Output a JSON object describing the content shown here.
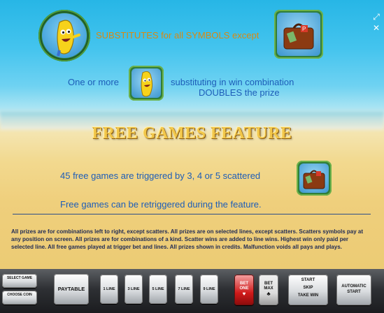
{
  "paytable": {
    "line1": "SUBSTITUTES for all SYMBOLS except",
    "line2_left": "One or more",
    "line2_right": "substituting in win combination",
    "line3": "DOUBLES the prize",
    "feature_title": "FREE GAMES FEATURE",
    "free_games_text": "45 free games are triggered by 3, 4 or 5 scattered",
    "retrigger_text": "Free games can be retriggered during the feature.",
    "terms": "All prizes are for combinations left to right, except scatters. All prizes are on selected lines, except scatters. Scatters symbols pay at any position on screen. All prizes are for combinations of a kind. Scatter wins are added to line wins. Highest win only paid per selected line. All free games played at trigger bet and lines. All prizes shown in credits. Malfunction voids all pays and plays."
  },
  "symbols": {
    "wild": "banana-wild-symbol",
    "scatter": "suitcase-scatter-symbol"
  },
  "side_icons": [
    "fullscreen-icon",
    "close-icon"
  ],
  "controls": {
    "select_game": "SELECT GAME",
    "choose_coin": "CHOOSE COIN",
    "paytable": "PAYTABLE",
    "lines": [
      "1 LINE",
      "3 LINE",
      "5 LINE",
      "7 LINE",
      "9 LINE"
    ],
    "bet_one": "BET ONE",
    "bet_max": "BET MAX",
    "start": "START",
    "skip": "SKIP",
    "take_win": "TAKE WIN",
    "automatic_start": "AUTOMATIC START"
  },
  "colors": {
    "gold_text": "#d88a12",
    "blue_text": "#1d5db8",
    "title": "#f2c74a",
    "bet_one": "#d01a1a"
  }
}
